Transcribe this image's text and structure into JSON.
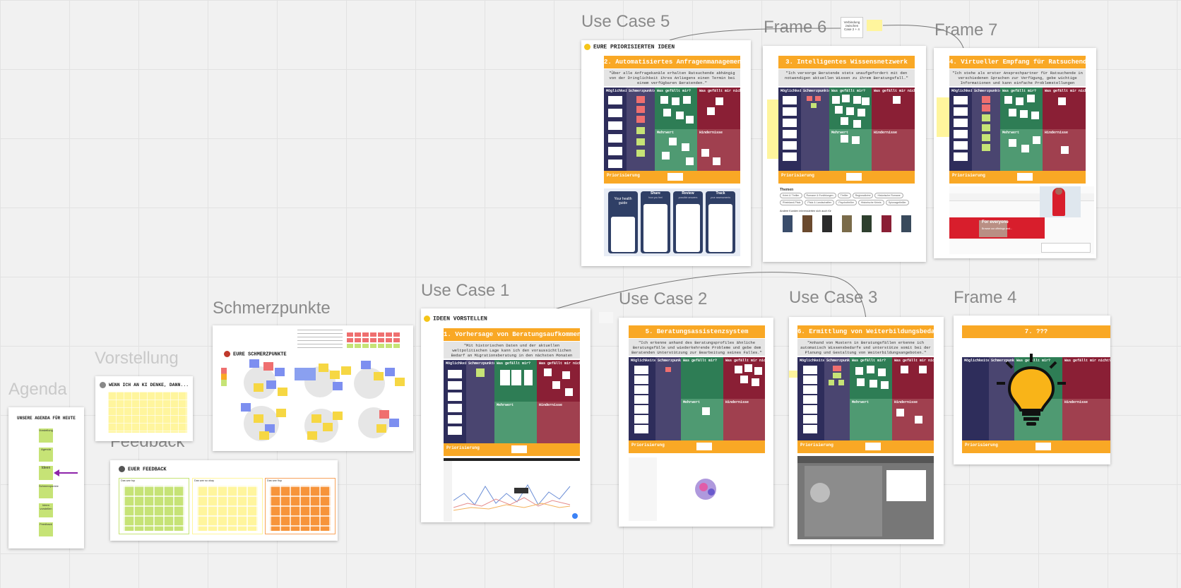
{
  "canvas": {
    "frames": {
      "use_case_5": "Use Case 5",
      "frame_6": "Frame 6",
      "frame_7": "Frame 7",
      "use_case_1": "Use Case 1",
      "use_case_2": "Use Case 2",
      "use_case_3": "Use Case 3",
      "frame_4": "Frame 4",
      "schmerzpunkte": "Schmerzpunkte",
      "vorstellung": "Vorstellung",
      "agenda": "Agenda",
      "feedback": "Feedback"
    },
    "small_note": "Verbindung zwischen Case 2 + 4"
  },
  "headers": {
    "prioritized": "EURE PRIORISIERTEN IDEEN",
    "present": "IDEEN VORSTELLEN",
    "pain": "EURE SCHMERZPUNKTE",
    "ki": "WENN ICH AN KI DENKE, DANN...",
    "feedback": "EUER FEEDBACK",
    "agenda": "UNSERE AGENDA FÜR HEUTE"
  },
  "cards": {
    "uc5": {
      "title": "2. Automatisiertes Anfragenmanagement",
      "quote": "\"Über alle Anfragekanäle erhalten Ratsuchende abhängig von der Dringlichkeit ihres Anliegens einen Termin bei einem verfügbaren Beratenden.\""
    },
    "f6": {
      "title": "3. Intelligentes Wissensnetzwerk",
      "quote": "\"Ich versorge Beratende stets unaufgefordert mit den notwendigen aktuellen Wissen zu ihrem Beratungsfall.\""
    },
    "f7": {
      "title": "4. Virtueller Empfang für Ratsuchende",
      "quote": "\"Ich stehe als erster Ansprechpartner für Ratsuchende in verschiedenen Sprachen zur Verfügung, gebe wichtige Informationen und kann einfache Problemstellungen lösen.\""
    },
    "uc1": {
      "title": "1. Vorhersage von Beratungsaufkommen",
      "quote": "\"Mit historischen Daten und der aktuellen weltpolitischen Lage kann ich den voraussichtlichen Bedarf an Migrationsberatung in den nächsten Monaten vorhersagen.\""
    },
    "uc2": {
      "title": "5. Beratungsassistenzsystem",
      "quote": "\"Ich erkenne anhand des Beratungsprofiles ähnliche Beratungsfälle und wiederkehrende Probleme und gebe dem Beratenden Unterstützung zur Bearbeitung seines Falles.\""
    },
    "uc3": {
      "title": "6. Ermittlung von Weiterbildungsbedarf",
      "quote": "\"Anhand von Mustern in Beratungsfällen erkenne ich automatisch Wissensbedarfe und unterstütze somit bei der Planung und Gestaltung von Weiterbildungsangeboten.\""
    },
    "f4": {
      "title": "7. ???",
      "quote": ""
    }
  },
  "columns": {
    "moeglichkeiten": "Möglichkeiten",
    "schmerzpunkte": "Schmerzpunkte",
    "gefaellt": "Was gefällt mir?",
    "gefaellt_nicht": "Was gefällt mir nicht?",
    "mehrwert": "Mehrwert",
    "hindernisse": "Hindernisse",
    "priorisierung": "Priorisierung"
  },
  "phone_screens": [
    {
      "title": "Your health guide",
      "sub": ""
    },
    {
      "title": "Share",
      "sub": "how you feel"
    },
    {
      "title": "Review",
      "sub": "possible answers"
    },
    {
      "title": "Track",
      "sub": "your assessments"
    }
  ],
  "themes": {
    "label": "Themen",
    "chips": [
      "Krimi & Thriller",
      "Romane & Erzählungen",
      "Thriller",
      "Regionalkrimi",
      "Historische Romane",
      "Rheinland-Pfalz",
      "Pfalz & Landschaften",
      "Psychothriller",
      "Historische Krimis",
      "Spionagethriller"
    ],
    "related": "Andere Kunden interessierten sich auch für"
  },
  "web": {
    "promo": "For everyone",
    "promo_sub": "Browse our offerings and…"
  },
  "feedback_cols": [
    "Das war top",
    "Das war so okay",
    "Das war flop"
  ],
  "agenda_items": [
    "Vorstellung",
    "Agenda",
    "Ideen",
    "Schmerzpunkte",
    "Ideen vorstellen",
    "Feedback"
  ],
  "colors": {
    "accent": "#f9a825",
    "dark_navy": "#2e2d5b",
    "green": "#2e7d55",
    "red": "#8a1f35",
    "arrow": "#8e24aa"
  }
}
